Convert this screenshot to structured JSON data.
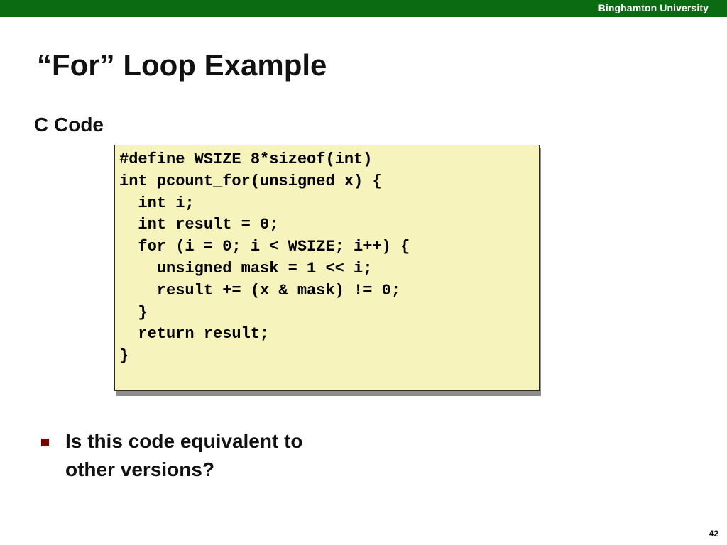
{
  "header": {
    "university": "Binghamton University"
  },
  "slide": {
    "title": "“For” Loop Example",
    "section_label": "C Code",
    "code_lines": [
      "#define WSIZE 8*sizeof(int)",
      "int pcount_for(unsigned x) {",
      "  int i;",
      "  int result = 0;",
      "  for (i = 0; i < WSIZE; i++) {",
      "    unsigned mask = 1 << i;",
      "    result += (x & mask) != 0;",
      "  }",
      "  return result;",
      "}"
    ],
    "bullets": [
      {
        "lines": [
          "Is this code equivalent to",
          "other versions?"
        ]
      }
    ],
    "page_number": "42"
  },
  "colors": {
    "top_bar": "#0a6b12",
    "code_background": "#f7f3bd",
    "bullet": "#7a0000"
  },
  "icons": {
    "bullet": "square-bullet-icon"
  }
}
